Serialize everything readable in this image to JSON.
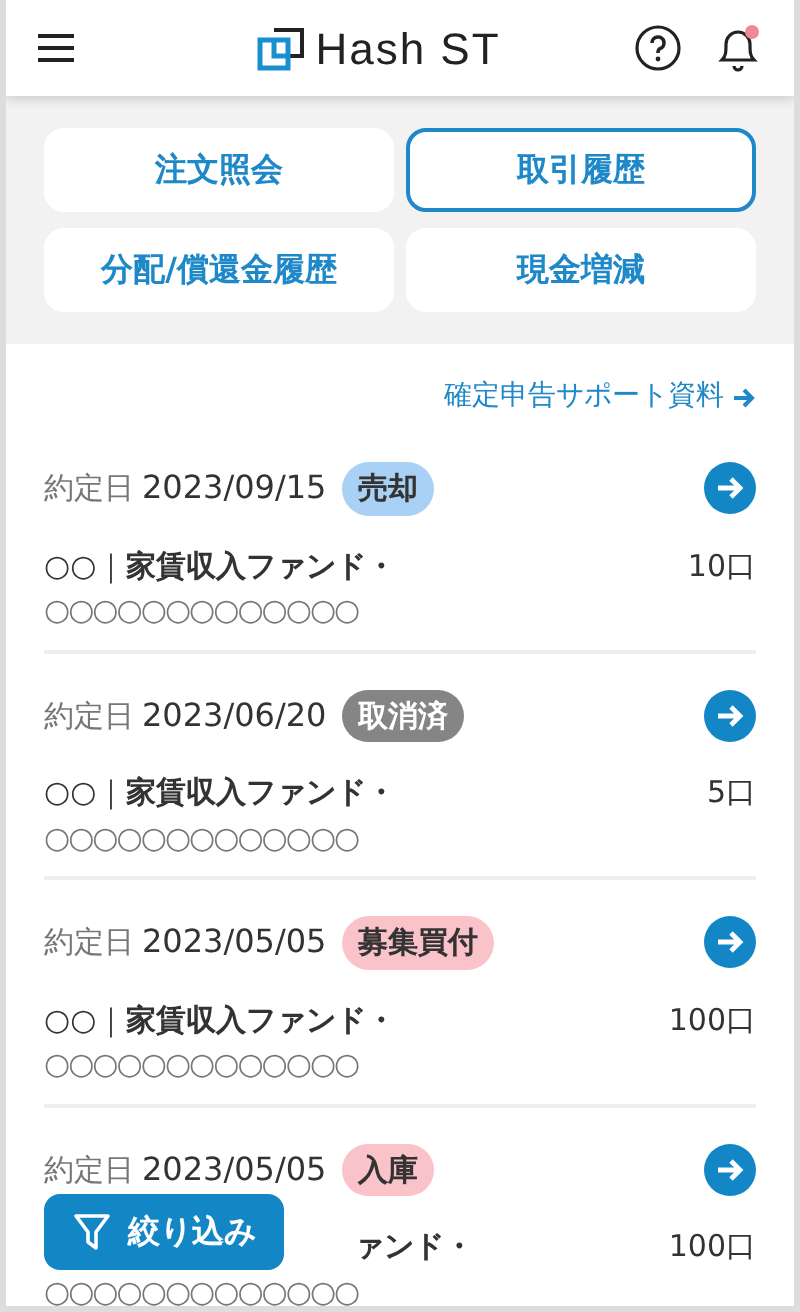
{
  "header": {
    "logo": "Hash ST"
  },
  "tabs": [
    {
      "label": "注文照会",
      "selected": false
    },
    {
      "label": "取引履歴",
      "selected": true
    },
    {
      "label": "分配/償還金履歴",
      "selected": false
    },
    {
      "label": "現金増減",
      "selected": false
    }
  ],
  "support_link": "確定申告サポート資料",
  "transactions": [
    {
      "date_label": "約定日",
      "date": "2023/09/15",
      "badge": {
        "label": "売却",
        "color": "#a9d1f5"
      },
      "name": "○○｜**家賃収入ファンド・**",
      "name_2": "○○○○○○○○○○○○○",
      "units": "10口"
    },
    {
      "date_label": "約定日",
      "date": "2023/06/20",
      "badge": {
        "label": "取消済",
        "color": "#858585"
      },
      "name": "○○｜**家賃収入ファンド・**",
      "name_2": "○○○○○○○○○○○○○",
      "units": "5口"
    },
    {
      "date_label": "約定日",
      "date": "2023/05/05",
      "badge": {
        "label": "募集買付",
        "color": "#fac3ca"
      },
      "name": "○○｜**家賃収入ファンド・**",
      "name_2": "○○○○○○○○○○○○○",
      "units": "100口"
    },
    {
      "date_label": "約定日",
      "date": "2023/05/05",
      "badge": {
        "label": "入庫",
        "color": "#fac3ca"
      },
      "name": "**ァンド・**",
      "name_2": "○○○○○○○○○○○○○",
      "units": "100口"
    }
  ],
  "filter_button": "絞り込み"
}
